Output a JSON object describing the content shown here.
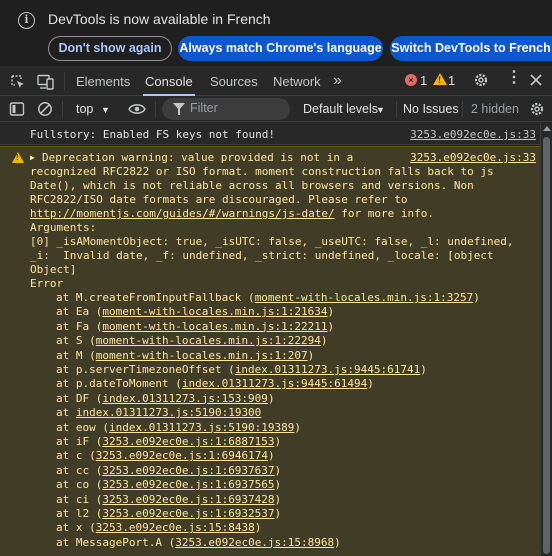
{
  "infobar": {
    "message": "DevTools is now available in French",
    "buttons": {
      "dont_show": "Don't show again",
      "always_match": "Always match Chrome's language",
      "switch": "Switch DevTools to French"
    }
  },
  "tabs": {
    "items": [
      "Elements",
      "Console",
      "Sources",
      "Network"
    ],
    "active": "Console",
    "more": "»",
    "error_count": "1",
    "warning_count": "1"
  },
  "filterbar": {
    "context": "top",
    "filter_placeholder": "Filter",
    "levels": "Default levels",
    "issues": "No Issues",
    "hidden": "2 hidden"
  },
  "console": {
    "info_message": "Fullstory: Enabled FS keys not found!",
    "info_source": "3253.e092ec0e.js:33",
    "warning_source": "3253.e092ec0e.js:33",
    "warning_lines": [
      "Deprecation warning: value provided is not in a",
      "recognized RFC2822 or ISO format. moment construction falls back to js",
      "Date(), which is not reliable across all browsers and versions. Non",
      "RFC2822/ISO date formats are discouraged. Please refer to"
    ],
    "warning_url": "http://momentjs.com/guides/#/warnings/js-date/",
    "warning_url_suffix": " for more info.",
    "arguments_label": "Arguments:",
    "arguments_lines": [
      "[0] _isAMomentObject: true, _isUTC: false, _useUTC: false, _l: undefined,",
      "_i:  Invalid date, _f: undefined, _strict: undefined, _locale: [object",
      "Object]"
    ],
    "error_label": "Error",
    "stack": [
      {
        "fn": "at M.createFromInputFallback (",
        "link": "moment-with-locales.min.js:1:3257",
        "end": ")"
      },
      {
        "fn": "at Ea (",
        "link": "moment-with-locales.min.js:1:21634",
        "end": ")"
      },
      {
        "fn": "at Fa (",
        "link": "moment-with-locales.min.js:1:22211",
        "end": ")"
      },
      {
        "fn": "at S (",
        "link": "moment-with-locales.min.js:1:22294",
        "end": ")"
      },
      {
        "fn": "at M (",
        "link": "moment-with-locales.min.js:1:207",
        "end": ")"
      },
      {
        "fn": "at p.serverTimezoneOffset (",
        "link": "index.01311273.js:9445:61741",
        "end": ")"
      },
      {
        "fn": "at p.dateToMoment (",
        "link": "index.01311273.js:9445:61494",
        "end": ")"
      },
      {
        "fn": "at DF (",
        "link": "index.01311273.js:153:909",
        "end": ")"
      },
      {
        "fn": "at ",
        "link": "index.01311273.js:5190:19300",
        "end": ""
      },
      {
        "fn": "at eow (",
        "link": "index.01311273.js:5190:19389",
        "end": ")"
      },
      {
        "fn": "at iF (",
        "link": "3253.e092ec0e.js:1:6887153",
        "end": ")"
      },
      {
        "fn": "at c (",
        "link": "3253.e092ec0e.js:1:6946174",
        "end": ")"
      },
      {
        "fn": "at cc (",
        "link": "3253.e092ec0e.js:1:6937637",
        "end": ")"
      },
      {
        "fn": "at co (",
        "link": "3253.e092ec0e.js:1:6937565",
        "end": ")"
      },
      {
        "fn": "at ci (",
        "link": "3253.e092ec0e.js:1:6937428",
        "end": ")"
      },
      {
        "fn": "at l2 (",
        "link": "3253.e092ec0e.js:1:6932537",
        "end": ")"
      },
      {
        "fn": "at x (",
        "link": "3253.e092ec0e.js:15:8438",
        "end": ")"
      },
      {
        "fn": "at MessagePort.A (",
        "link": "3253.e092ec0e.js:15:8968",
        "end": ")"
      }
    ]
  }
}
